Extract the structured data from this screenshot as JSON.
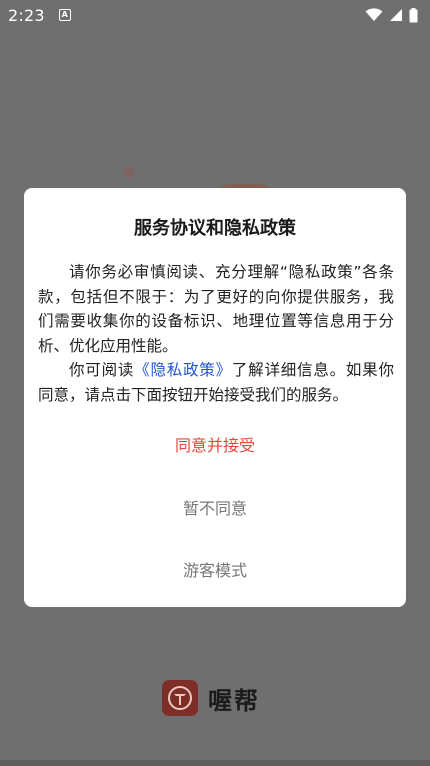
{
  "status_bar": {
    "time": "2:23",
    "notification_icon": "a-notification-icon",
    "icons": [
      "wifi-icon",
      "signal-icon",
      "battery-icon"
    ]
  },
  "dialog": {
    "title": "服务协议和隐私政策",
    "paragraph1": "请你务必审慎阅读、充分理解“隐私政策”各条款，包括但不限于：为了更好的向你提供服务，我们需要收集你的设备标识、地理位置等信息用于分析、优化应用性能。",
    "paragraph2_prefix": "你可阅读",
    "paragraph2_link": "《隐私政策》",
    "paragraph2_suffix": "了解详细信息。如果你同意，请点击下面按钮开始接受我们的服务。",
    "accept_label": "同意并接受",
    "decline_label": "暂不同意",
    "guest_label": "游客模式"
  },
  "brand": {
    "name": "喔帮",
    "logo_icon": "brand-logo-icon",
    "logo_color": "#7e2e26"
  },
  "colors": {
    "accept": "#e8473a",
    "link": "#2255cc",
    "overlay": "#6f6f6f"
  }
}
